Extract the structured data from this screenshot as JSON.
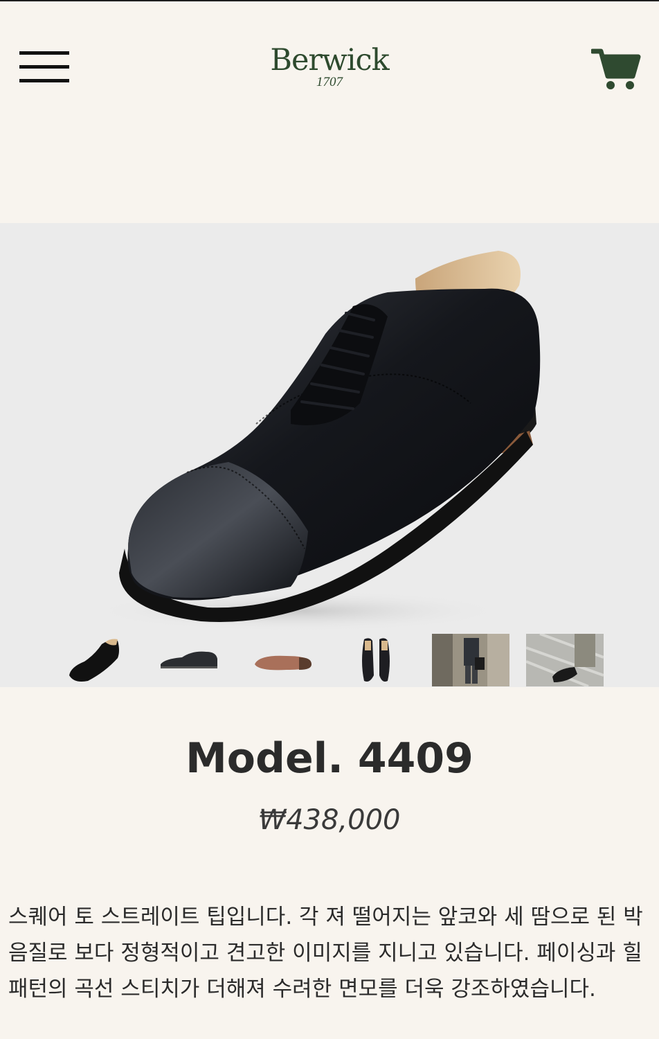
{
  "header": {
    "brand_name": "Berwick",
    "brand_year": "1707",
    "menu_icon": "hamburger-menu-icon",
    "cart_icon": "shopping-cart-icon"
  },
  "gallery": {
    "thumbnails": [
      "shoe-angle-view",
      "shoe-side-view",
      "shoe-sole-view",
      "shoe-pair-top-view",
      "model-wearing-shoes",
      "shoe-on-street"
    ],
    "selected_index": 0
  },
  "product": {
    "title": "Model. 4409",
    "price": "₩438,000",
    "description": " 스퀘어 토 스트레이트 팁입니다. 각 져 떨어지는 앞코와 세 땀으로 된 박음질로 보다 정형적이고 견고한 이미지를 지니고 있습니다. 페이싱과 힐 패턴의 곡선 스티치가 더해져 수려한 면모를 더욱 강조하였습니다."
  },
  "colors": {
    "background": "#f8f4ee",
    "brand_green": "#2e4a2e",
    "hero_background": "#ebebeb"
  }
}
